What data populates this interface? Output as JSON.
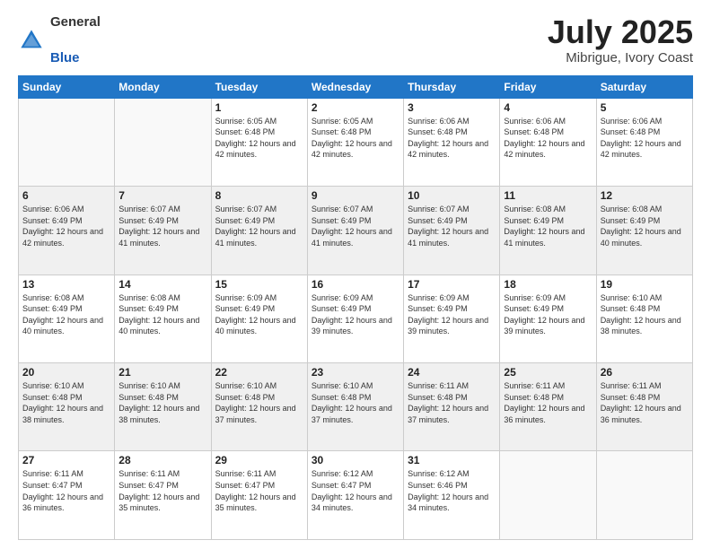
{
  "logo": {
    "general": "General",
    "blue": "Blue"
  },
  "header": {
    "month": "July 2025",
    "location": "Mibrigue, Ivory Coast"
  },
  "weekdays": [
    "Sunday",
    "Monday",
    "Tuesday",
    "Wednesday",
    "Thursday",
    "Friday",
    "Saturday"
  ],
  "weeks": [
    [
      {
        "day": "",
        "info": ""
      },
      {
        "day": "",
        "info": ""
      },
      {
        "day": "1",
        "info": "Sunrise: 6:05 AM\nSunset: 6:48 PM\nDaylight: 12 hours and 42 minutes."
      },
      {
        "day": "2",
        "info": "Sunrise: 6:05 AM\nSunset: 6:48 PM\nDaylight: 12 hours and 42 minutes."
      },
      {
        "day": "3",
        "info": "Sunrise: 6:06 AM\nSunset: 6:48 PM\nDaylight: 12 hours and 42 minutes."
      },
      {
        "day": "4",
        "info": "Sunrise: 6:06 AM\nSunset: 6:48 PM\nDaylight: 12 hours and 42 minutes."
      },
      {
        "day": "5",
        "info": "Sunrise: 6:06 AM\nSunset: 6:48 PM\nDaylight: 12 hours and 42 minutes."
      }
    ],
    [
      {
        "day": "6",
        "info": "Sunrise: 6:06 AM\nSunset: 6:49 PM\nDaylight: 12 hours and 42 minutes."
      },
      {
        "day": "7",
        "info": "Sunrise: 6:07 AM\nSunset: 6:49 PM\nDaylight: 12 hours and 41 minutes."
      },
      {
        "day": "8",
        "info": "Sunrise: 6:07 AM\nSunset: 6:49 PM\nDaylight: 12 hours and 41 minutes."
      },
      {
        "day": "9",
        "info": "Sunrise: 6:07 AM\nSunset: 6:49 PM\nDaylight: 12 hours and 41 minutes."
      },
      {
        "day": "10",
        "info": "Sunrise: 6:07 AM\nSunset: 6:49 PM\nDaylight: 12 hours and 41 minutes."
      },
      {
        "day": "11",
        "info": "Sunrise: 6:08 AM\nSunset: 6:49 PM\nDaylight: 12 hours and 41 minutes."
      },
      {
        "day": "12",
        "info": "Sunrise: 6:08 AM\nSunset: 6:49 PM\nDaylight: 12 hours and 40 minutes."
      }
    ],
    [
      {
        "day": "13",
        "info": "Sunrise: 6:08 AM\nSunset: 6:49 PM\nDaylight: 12 hours and 40 minutes."
      },
      {
        "day": "14",
        "info": "Sunrise: 6:08 AM\nSunset: 6:49 PM\nDaylight: 12 hours and 40 minutes."
      },
      {
        "day": "15",
        "info": "Sunrise: 6:09 AM\nSunset: 6:49 PM\nDaylight: 12 hours and 40 minutes."
      },
      {
        "day": "16",
        "info": "Sunrise: 6:09 AM\nSunset: 6:49 PM\nDaylight: 12 hours and 39 minutes."
      },
      {
        "day": "17",
        "info": "Sunrise: 6:09 AM\nSunset: 6:49 PM\nDaylight: 12 hours and 39 minutes."
      },
      {
        "day": "18",
        "info": "Sunrise: 6:09 AM\nSunset: 6:49 PM\nDaylight: 12 hours and 39 minutes."
      },
      {
        "day": "19",
        "info": "Sunrise: 6:10 AM\nSunset: 6:48 PM\nDaylight: 12 hours and 38 minutes."
      }
    ],
    [
      {
        "day": "20",
        "info": "Sunrise: 6:10 AM\nSunset: 6:48 PM\nDaylight: 12 hours and 38 minutes."
      },
      {
        "day": "21",
        "info": "Sunrise: 6:10 AM\nSunset: 6:48 PM\nDaylight: 12 hours and 38 minutes."
      },
      {
        "day": "22",
        "info": "Sunrise: 6:10 AM\nSunset: 6:48 PM\nDaylight: 12 hours and 37 minutes."
      },
      {
        "day": "23",
        "info": "Sunrise: 6:10 AM\nSunset: 6:48 PM\nDaylight: 12 hours and 37 minutes."
      },
      {
        "day": "24",
        "info": "Sunrise: 6:11 AM\nSunset: 6:48 PM\nDaylight: 12 hours and 37 minutes."
      },
      {
        "day": "25",
        "info": "Sunrise: 6:11 AM\nSunset: 6:48 PM\nDaylight: 12 hours and 36 minutes."
      },
      {
        "day": "26",
        "info": "Sunrise: 6:11 AM\nSunset: 6:48 PM\nDaylight: 12 hours and 36 minutes."
      }
    ],
    [
      {
        "day": "27",
        "info": "Sunrise: 6:11 AM\nSunset: 6:47 PM\nDaylight: 12 hours and 36 minutes."
      },
      {
        "day": "28",
        "info": "Sunrise: 6:11 AM\nSunset: 6:47 PM\nDaylight: 12 hours and 35 minutes."
      },
      {
        "day": "29",
        "info": "Sunrise: 6:11 AM\nSunset: 6:47 PM\nDaylight: 12 hours and 35 minutes."
      },
      {
        "day": "30",
        "info": "Sunrise: 6:12 AM\nSunset: 6:47 PM\nDaylight: 12 hours and 34 minutes."
      },
      {
        "day": "31",
        "info": "Sunrise: 6:12 AM\nSunset: 6:46 PM\nDaylight: 12 hours and 34 minutes."
      },
      {
        "day": "",
        "info": ""
      },
      {
        "day": "",
        "info": ""
      }
    ]
  ]
}
